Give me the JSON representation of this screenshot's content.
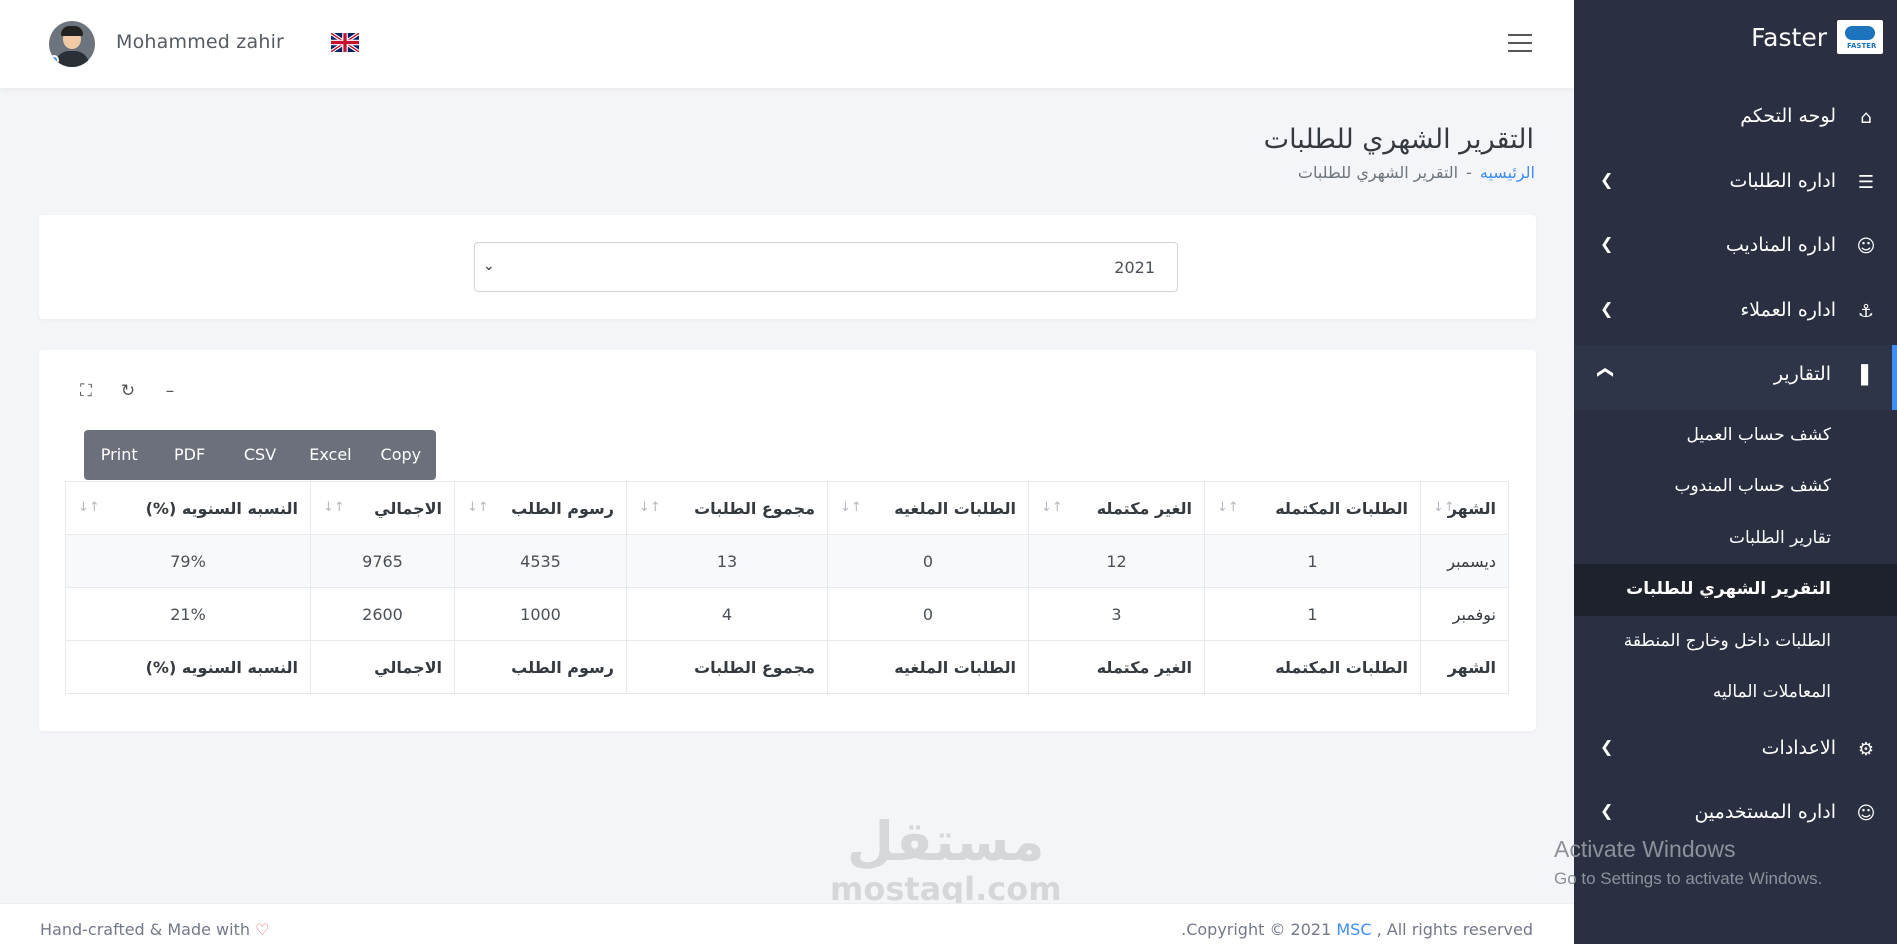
{
  "header": {
    "username": "Mohammed zahir",
    "flag_icon": "uk-flag-icon",
    "menu_icon": "hamburger-icon"
  },
  "page": {
    "title": "التقرير الشهري للطلبات",
    "breadcrumb_home": "الرئيسيه",
    "breadcrumb_sep": "-",
    "breadcrumb_current": "التقرير الشهري للطلبات"
  },
  "filter": {
    "year": "2021"
  },
  "export_buttons": {
    "print": "Print",
    "pdf": "PDF",
    "csv": "CSV",
    "excel": "Excel",
    "copy": "Copy"
  },
  "table": {
    "headers": [
      "الشهر",
      "الطلبات المكتمله",
      "الغير مكتمله",
      "الطلبات الملغيه",
      "مجموع الطلبات",
      "رسوم الطلب",
      "الاجمالي",
      "النسبه السنويه (%)"
    ],
    "rows": [
      [
        "ديسمبر",
        "1",
        "12",
        "0",
        "13",
        "4535",
        "9765",
        "79%"
      ],
      [
        "نوفمبر",
        "1",
        "3",
        "0",
        "4",
        "1000",
        "2600",
        "21%"
      ]
    ]
  },
  "sidebar": {
    "brand": "Faster",
    "brand_logo_text": "FASTER",
    "items": [
      {
        "label": "لوحه التحكم",
        "icon": "home-icon"
      },
      {
        "label": "اداره الطلبات",
        "icon": "list-check-icon"
      },
      {
        "label": "اداره المناديب",
        "icon": "users-icon"
      },
      {
        "label": "اداره العملاء",
        "icon": "anchor-icon"
      },
      {
        "label": "التقارير",
        "icon": "bar-chart-icon"
      },
      {
        "label": "الاعدادات",
        "icon": "gear-icon"
      },
      {
        "label": "اداره المستخدمين",
        "icon": "user-icon"
      }
    ],
    "report_subitems": [
      "كشف حساب العميل",
      "كشف حساب المندوب",
      "تقارير الطلبات",
      "التقرير الشهري للطلبات",
      "الطلبات داخل وخارج المنطقة",
      "المعاملات الماليه"
    ]
  },
  "windows_notice": {
    "line1": "Activate Windows",
    "line2": "Go to Settings to activate Windows."
  },
  "watermark": {
    "arabic": "مستقل",
    "latin": "mostaql.com"
  },
  "footer": {
    "left": "Hand-crafted & Made with",
    "right_prefix": ".Copyright © 2021",
    "right_brand": "MSC",
    "right_suffix": ", All rights reserved"
  },
  "colors": {
    "sidebar_bg": "#2a3042",
    "accent": "#3d8ef8",
    "button_group": "#6c707c"
  }
}
